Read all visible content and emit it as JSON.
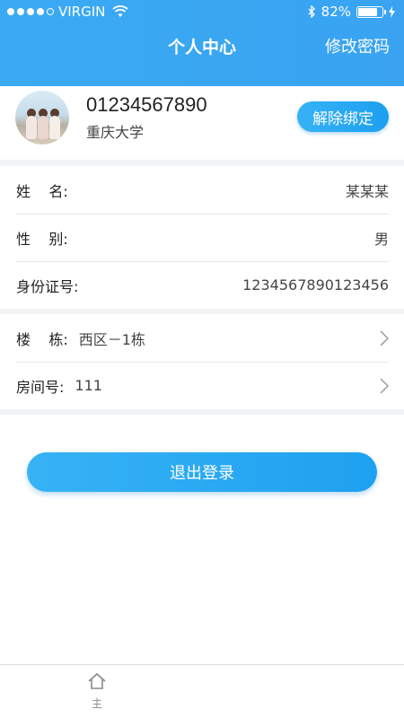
{
  "status": {
    "carrier": "VIRGIN",
    "battery_percent": "82%",
    "battery_level": 0.82
  },
  "nav": {
    "title": "个人中心",
    "right_action": "修改密码"
  },
  "profile": {
    "phone": "01234567890",
    "school": "重庆大学",
    "unbind_label": "解除绑定"
  },
  "info": {
    "name_label": "姓    名:",
    "name_value": "某某某",
    "gender_label": "性    别:",
    "gender_value": "男",
    "id_label": "身份证号:",
    "id_value": "1234567890123456"
  },
  "dorm": {
    "building_label": "楼    栋:",
    "building_value": "西区－1栋",
    "room_label": "房间号:",
    "room_value": "111"
  },
  "logout_label": "退出登录",
  "tabbar": {
    "home_label": "主"
  }
}
